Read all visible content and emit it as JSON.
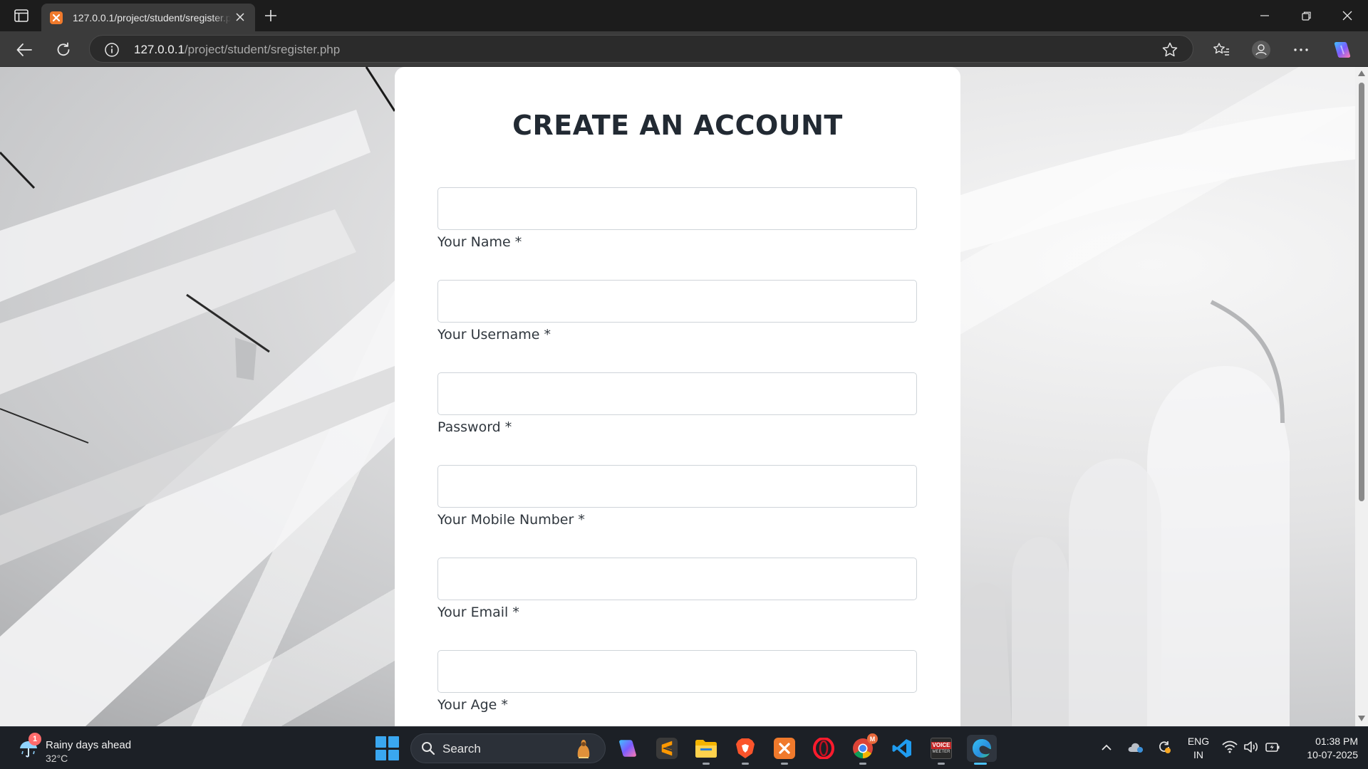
{
  "browser": {
    "tab_title": "127.0.0.1/project/student/sregister.php",
    "url_host": "127.0.0.1",
    "url_path": "/project/student/sregister.php"
  },
  "form": {
    "title": "CREATE AN ACCOUNT",
    "fields": [
      {
        "label": "Your Name *",
        "value": ""
      },
      {
        "label": "Your Username *",
        "value": ""
      },
      {
        "label": "Password *",
        "value": ""
      },
      {
        "label": "Your Mobile Number *",
        "value": ""
      },
      {
        "label": "Your Email *",
        "value": ""
      },
      {
        "label": "Your Age *",
        "value": ""
      }
    ]
  },
  "taskbar": {
    "weather_badge": "1",
    "weather_title": "Rainy days ahead",
    "weather_temp": "32°C",
    "search_label": "Search",
    "apps": [
      "copilot",
      "sublime-text",
      "file-explorer",
      "brave",
      "xampp",
      "opera",
      "chrome",
      "vscode",
      "voicemeeter",
      "edge"
    ],
    "lang_top": "ENG",
    "lang_bottom": "IN",
    "time": "01:38 PM",
    "date": "10-07-2025",
    "chrome_badge": "M",
    "voicemeeter_label_top": "VOICE",
    "voicemeeter_label_bottom": "MEETER"
  },
  "colors": {
    "tab_active": "#3b3b3b",
    "titlebar": "#1c1c1c",
    "taskbar": "#1c2026",
    "accent": "#4cc2ff",
    "xampp_orange": "#f07a2c"
  }
}
